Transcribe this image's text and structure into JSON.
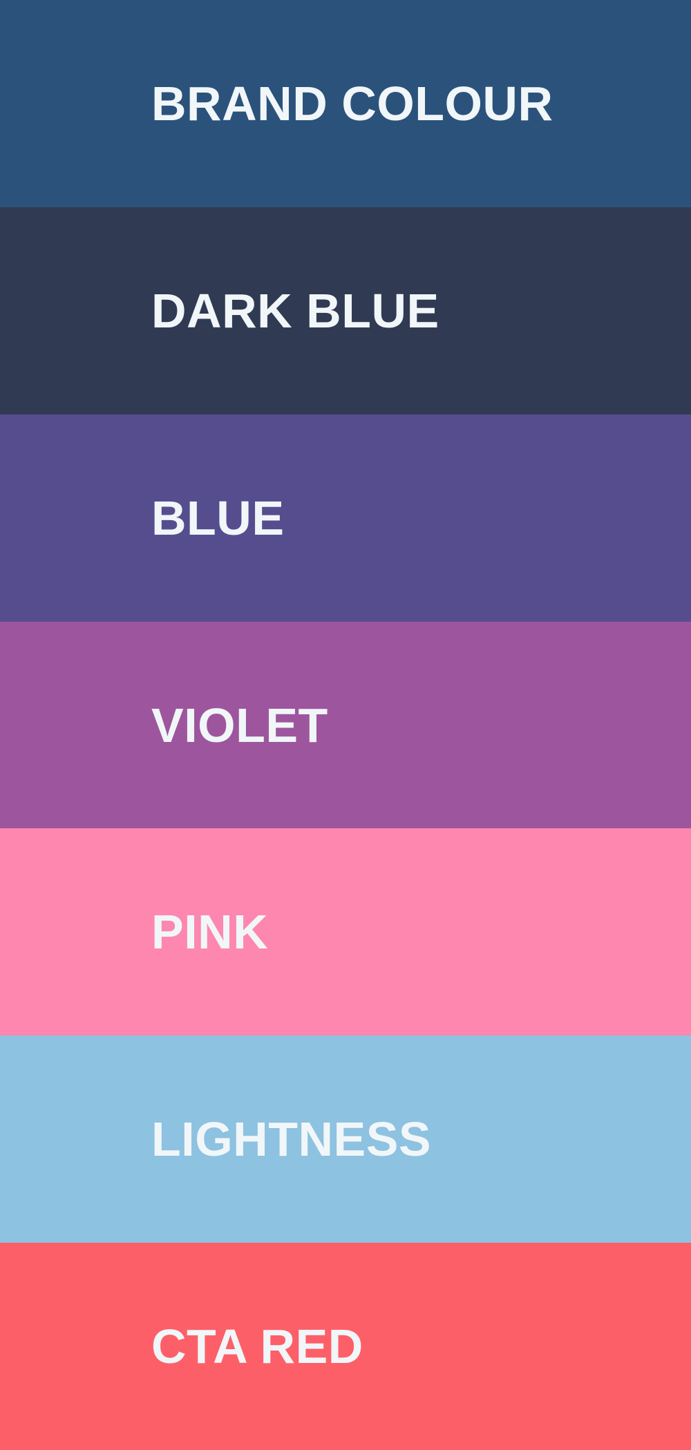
{
  "swatches": [
    {
      "label": "BRAND COLOUR",
      "color": "#2B527B"
    },
    {
      "label": "DARK BLUE",
      "color": "#313A53"
    },
    {
      "label": "BLUE",
      "color": "#564D8F"
    },
    {
      "label": "VIOLET",
      "color": "#9D569D"
    },
    {
      "label": "PINK",
      "color": "#FD87AE"
    },
    {
      "label": "LIGHTNESS",
      "color": "#8DC2E1"
    },
    {
      "label": "CTA RED",
      "color": "#FD5F69"
    }
  ]
}
